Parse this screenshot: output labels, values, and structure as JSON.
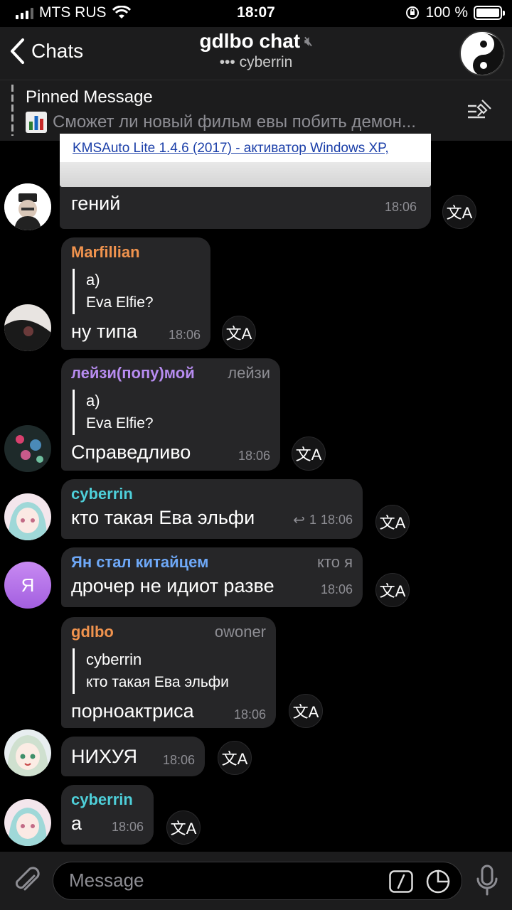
{
  "status": {
    "carrier": "MTS RUS",
    "time": "18:07",
    "battery": "100 %"
  },
  "header": {
    "back_label": "Chats",
    "title": "gdlbo chat",
    "subtitle": "••• cyberrin"
  },
  "pinned": {
    "title": "Pinned Message",
    "text": "Сможет ли новый фильм евы побить демон..."
  },
  "image_preview": {
    "link_text": "KMSAuto Lite 1.4.6 (2017) - активатор Windows XP,"
  },
  "messages": [
    {
      "text": "гений",
      "time": "18:06"
    },
    {
      "sender": "Marfillian",
      "sender_color": "#f0934e",
      "reply_name": "a)",
      "reply_text": "Eva Elfie?",
      "text": "ну типа",
      "time": "18:06"
    },
    {
      "sender": "лейзи(попу)мой",
      "sender_color": "#b78cf0",
      "role": "лейзи",
      "reply_name": "a)",
      "reply_text": "Eva Elfie?",
      "text": "Справедливо",
      "time": "18:06"
    },
    {
      "sender": "cyberrin",
      "sender_color": "#4ecfd9",
      "text": "кто такая Ева эльфи",
      "replies": "1",
      "time": "18:06"
    },
    {
      "sender": "Ян стал китайцем",
      "sender_color": "#6ea8f7",
      "role": "кто я",
      "text": "дрочер не идиот разве",
      "time": "18:06",
      "avatar_letter": "Я"
    },
    {
      "sender": "gdlbo",
      "sender_color": "#f0934e",
      "role": "owoner",
      "reply_name": "cyberrin",
      "reply_text": "кто такая Ева эльфи",
      "text": "порноактриса",
      "time": "18:06"
    },
    {
      "text": "НИХУЯ",
      "time": "18:06"
    },
    {
      "sender": "cyberrin",
      "sender_color": "#4ecfd9",
      "text": "а",
      "time": "18:06"
    }
  ],
  "input": {
    "placeholder": "Message"
  },
  "colors": {
    "bubble": "#262628",
    "header": "#1c1c1d",
    "meta": "#8d8d93"
  },
  "icons": [
    "chevron-left-icon",
    "mute-icon",
    "chart-icon",
    "pin-list-icon",
    "translate-icon",
    "reply-icon",
    "attach-icon",
    "command-icon",
    "sticker-icon",
    "mic-icon"
  ]
}
